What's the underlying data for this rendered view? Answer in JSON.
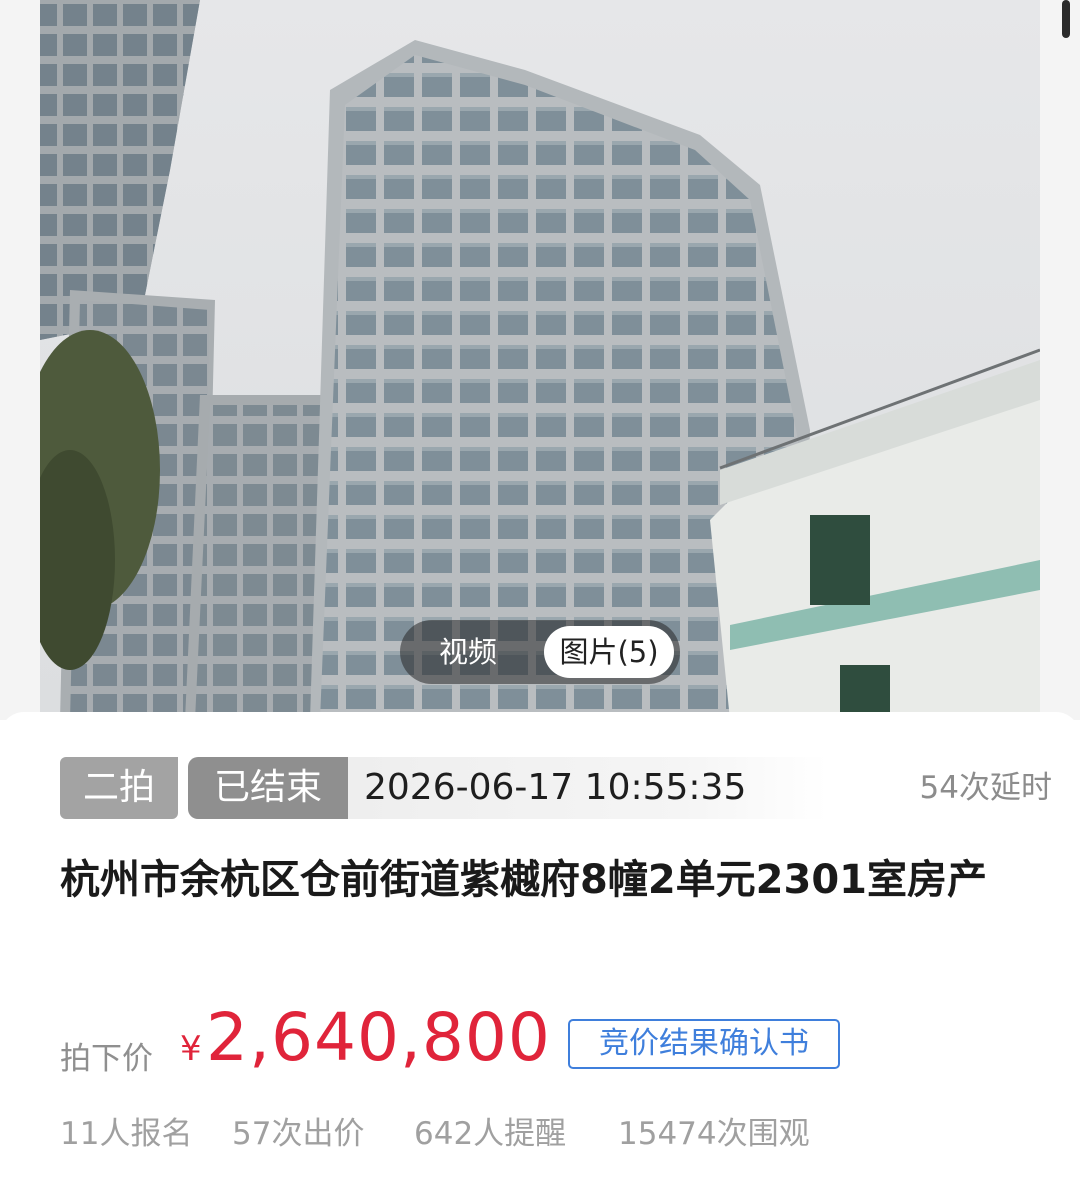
{
  "media": {
    "video_tab": "视频",
    "images_tab": "图片(5)",
    "photo_icon": "building-photo"
  },
  "auction": {
    "round_badge": "二拍",
    "status_badge": "已结束",
    "end_time": "2026-06-17 10:55:35",
    "extension_count": "54次延时"
  },
  "property": {
    "title": "杭州市余杭区仓前街道紫樾府8幢2单元2301室房产"
  },
  "price": {
    "label": "拍下价",
    "currency": "¥",
    "value": "2,640,800",
    "report_button": "竞价结果确认书",
    "color": "#e0243a"
  },
  "stats": {
    "signups": "11人报名",
    "bids": "57次出价",
    "reminders": "642人提醒",
    "views": "15474次围观"
  },
  "colors": {
    "accent_red": "#e0243a",
    "link_blue": "#3f7fdc",
    "badge_gray": "#a3a3a3"
  }
}
